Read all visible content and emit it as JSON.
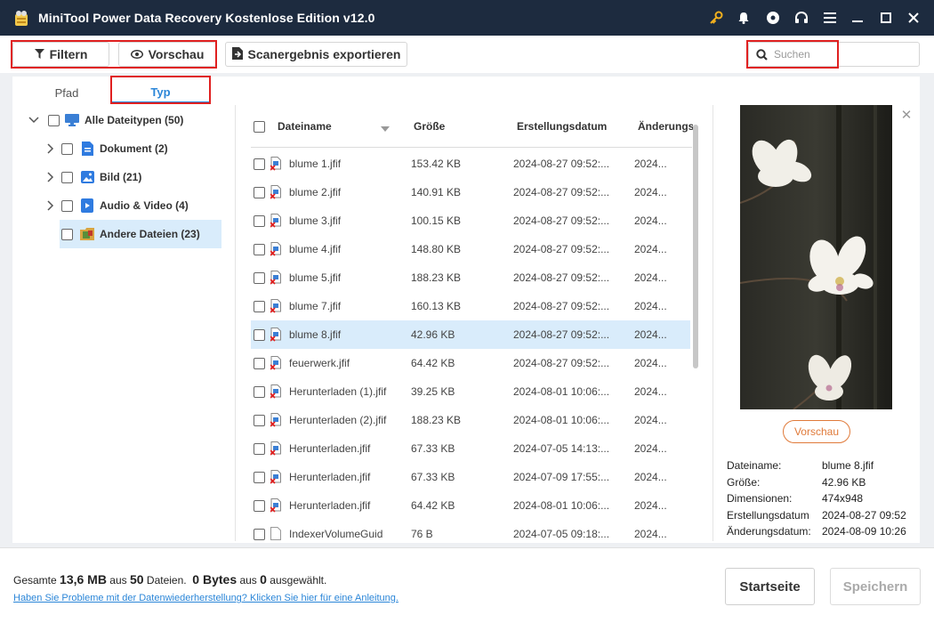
{
  "window": {
    "title": "MiniTool Power Data Recovery Kostenlose Edition v12.0",
    "icons": [
      "key-icon",
      "bell-icon",
      "disc-icon",
      "headset-icon",
      "menu-icon",
      "minimize-icon",
      "maximize-icon",
      "close-icon"
    ],
    "title_bar_color": "#1d2b3f"
  },
  "toolbar": {
    "filter_label": "Filtern",
    "preview_label": "Vorschau",
    "export_label": "Scanergebnis exportieren",
    "search_placeholder": "Suchen"
  },
  "tabs": [
    {
      "label": "Pfad",
      "active": false
    },
    {
      "label": "Typ",
      "active": true
    }
  ],
  "tree": [
    {
      "label": "Alle Dateitypen (50)",
      "icon": "monitor-icon",
      "expanded": true
    },
    {
      "label": "Dokument (2)",
      "icon": "document-icon",
      "expanded": false
    },
    {
      "label": "Bild (21)",
      "icon": "image-icon",
      "expanded": false
    },
    {
      "label": "Audio & Video (4)",
      "icon": "media-icon",
      "expanded": false
    },
    {
      "label": "Andere Dateien (23)",
      "icon": "folder-icon",
      "selected": true
    }
  ],
  "columns": {
    "name": "Dateiname",
    "size": "Größe",
    "created": "Erstellungsdatum",
    "modified": "Änderungs"
  },
  "files": [
    {
      "name": "blume 1.jfif",
      "size": "153.42 KB",
      "created": "2024-08-27 09:52:...",
      "modified": "2024..."
    },
    {
      "name": "blume 2.jfif",
      "size": "140.91 KB",
      "created": "2024-08-27 09:52:...",
      "modified": "2024..."
    },
    {
      "name": "blume 3.jfif",
      "size": "100.15 KB",
      "created": "2024-08-27 09:52:...",
      "modified": "2024..."
    },
    {
      "name": "blume 4.jfif",
      "size": "148.80 KB",
      "created": "2024-08-27 09:52:...",
      "modified": "2024..."
    },
    {
      "name": "blume 5.jfif",
      "size": "188.23 KB",
      "created": "2024-08-27 09:52:...",
      "modified": "2024..."
    },
    {
      "name": "blume 7.jfif",
      "size": "160.13 KB",
      "created": "2024-08-27 09:52:...",
      "modified": "2024..."
    },
    {
      "name": "blume 8.jfif",
      "size": "42.96 KB",
      "created": "2024-08-27 09:52:...",
      "modified": "2024...",
      "selected": true
    },
    {
      "name": "feuerwerk.jfif",
      "size": "64.42 KB",
      "created": "2024-08-27 09:52:...",
      "modified": "2024..."
    },
    {
      "name": "Herunterladen (1).jfif",
      "size": "39.25 KB",
      "created": "2024-08-01 10:06:...",
      "modified": "2024..."
    },
    {
      "name": "Herunterladen (2).jfif",
      "size": "188.23 KB",
      "created": "2024-08-01 10:06:...",
      "modified": "2024..."
    },
    {
      "name": "Herunterladen.jfif",
      "size": "67.33 KB",
      "created": "2024-07-05 14:13:...",
      "modified": "2024..."
    },
    {
      "name": "Herunterladen.jfif",
      "size": "67.33 KB",
      "created": "2024-07-09 17:55:...",
      "modified": "2024..."
    },
    {
      "name": "Herunterladen.jfif",
      "size": "64.42 KB",
      "created": "2024-08-01 10:06:...",
      "modified": "2024..."
    },
    {
      "name": "IndexerVolumeGuid",
      "size": "76 B",
      "created": "2024-07-05 09:18:...",
      "modified": "2024...",
      "plain": true
    }
  ],
  "preview": {
    "button_label": "Vorschau",
    "meta": [
      {
        "label": "Dateiname:",
        "value": "blume 8.jfif"
      },
      {
        "label": "Größe:",
        "value": "42.96 KB"
      },
      {
        "label": "Dimensionen:",
        "value": "474x948"
      },
      {
        "label": "Erstellungsdatum",
        "value": "2024-08-27 09:52"
      },
      {
        "label": "Änderungsdatum:",
        "value": "2024-08-09 10:26"
      }
    ]
  },
  "footer": {
    "summary_prefix": "Gesamte",
    "total_size": "13,6 MB",
    "summary_mid": "aus",
    "total_files": "50",
    "summary_files": "Dateien.",
    "selected_size": "0 Bytes",
    "summary_aus": "aus",
    "selected_count": "0",
    "summary_suffix": "ausgewählt.",
    "help_link": "Haben Sie Probleme mit der Datenwiederherstellung? Klicken Sie hier für eine Anleitung.",
    "home_label": "Startseite",
    "save_label": "Speichern"
  },
  "colors": {
    "accent": "#2b86d8",
    "highlight_box": "#e02020",
    "preview_button": "#e07a3a",
    "selected_row": "#d9ecfb"
  }
}
